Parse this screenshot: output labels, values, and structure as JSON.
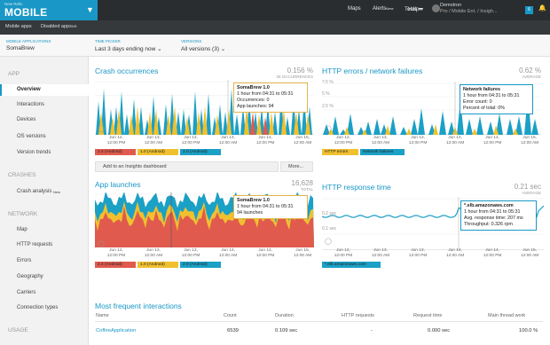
{
  "topbar": {
    "brand_small": "New Relic.",
    "brand_big": "MOBILE",
    "maps": "Maps",
    "alerts": "Alerts",
    "alerts_badge": "New",
    "tools": "Tools",
    "help": "Help",
    "user_name": "Demotron",
    "user_account": "Pro / Mobile Ent. / Insigh...",
    "notif_count": "6"
  },
  "subbar": {
    "mobile_apps": "Mobile apps",
    "disabled_apps": "Disabled apps",
    "disabled_badge": "NR"
  },
  "context": {
    "app_label": "MOBILE APPLICATIONS",
    "app_value": "SomaBrew",
    "time_label": "TIME PICKER",
    "time_value": "Last 3 days ending now",
    "versions_label": "VERSIONS",
    "versions_value": "All versions (3)"
  },
  "sidebar": {
    "sections": [
      {
        "title": "APP",
        "items": [
          {
            "label": "Overview",
            "active": true
          },
          {
            "label": "Interactions"
          },
          {
            "label": "Devices"
          },
          {
            "label": "OS versions"
          },
          {
            "label": "Version trends"
          }
        ]
      },
      {
        "title": "CRASHES",
        "items": [
          {
            "label": "Crash analysis",
            "badge": "New"
          }
        ]
      },
      {
        "title": "NETWORK",
        "items": [
          {
            "label": "Map"
          },
          {
            "label": "HTTP requests"
          },
          {
            "label": "Errors"
          },
          {
            "label": "Geography"
          },
          {
            "label": "Carriers"
          },
          {
            "label": "Connection types"
          }
        ]
      },
      {
        "title": "USAGE",
        "items": []
      }
    ]
  },
  "colors": {
    "accent": "#1997c6",
    "android24": "#e05a4e",
    "android10": "#f0c02f",
    "android20": "#1ba0c6",
    "http_err": "#f0c02f",
    "net_fail": "#1ba0c6",
    "tooltip_border": "#e3b44a"
  },
  "panels": {
    "crash": {
      "title": "Crash occurrences",
      "metric": "0.156",
      "metric_unit": "%",
      "metric_sub": "26 OCCURRENCES",
      "tooltip": {
        "title": "SomaBrew 1.0",
        "line1": "1 hour from 04:31 to 05:31",
        "line2": "Occurrences: 0",
        "line3": "App launches: 94"
      },
      "add_insights": "Add to an Insights dashboard",
      "more": "More..."
    },
    "http": {
      "title": "HTTP errors / network failures",
      "metric": "0.62",
      "metric_unit": "%",
      "metric_sub": "AVERAGE",
      "tooltip": {
        "title": "Network failures",
        "line1": "1 hour from 04:31 to 05:31",
        "line2": "Error count: 0",
        "line3": "Percent of total: 0%"
      }
    },
    "launches": {
      "title": "App launches",
      "metric": "16,628",
      "metric_sub": "TOTAL",
      "tooltip": {
        "title": "SomaBrew 1.0",
        "line1": "1 hour from 04:31 to 05:31",
        "line2": "94 launches"
      }
    },
    "response": {
      "title": "HTTP response time",
      "metric": "0.21",
      "metric_unit": "sec",
      "metric_sub": "AVERAGE",
      "tooltip": {
        "title": "*.elb.amazonaws.com",
        "line1": "1 hour from 04:31 to 05:31",
        "line2": "Avg. response time: 207 ms",
        "line3": "Throughput: 0.326 rpm"
      }
    }
  },
  "chart_data": [
    {
      "type": "area",
      "title": "Crash occurrences",
      "x": [
        "Jun 12, 12:00 PM",
        "Jun 13, 12:00 AM",
        "Jun 13, 12:00 PM",
        "Jun 14, 12:00 AM",
        "Jun 14, 12:00 PM",
        "Jun 15, 12:00 AM"
      ],
      "series": [
        {
          "name": "2.4 (Android)",
          "color": "#e05a4e",
          "values": [
            0,
            0,
            0,
            0,
            0,
            0,
            0,
            0,
            0,
            0,
            0,
            0,
            0,
            0,
            0,
            0,
            0,
            0,
            0,
            0,
            0,
            0,
            0,
            0,
            0,
            0,
            0,
            0,
            0,
            0,
            0,
            0,
            0,
            0,
            0,
            0,
            0,
            0,
            0,
            0,
            0,
            0,
            0,
            0,
            0,
            0,
            0,
            0,
            0,
            0,
            0,
            0,
            0,
            0,
            0,
            0,
            0,
            0,
            0,
            0,
            0,
            0,
            0,
            0,
            0,
            0,
            0,
            0,
            0,
            0,
            0,
            0,
            0,
            0,
            0,
            0,
            0,
            0,
            0,
            0,
            0,
            0,
            0,
            0,
            0,
            0,
            0,
            0,
            0,
            0,
            0,
            0,
            0,
            0,
            0,
            0,
            0,
            0,
            0,
            0,
            0,
            0,
            0,
            0,
            0,
            0,
            0,
            0,
            0,
            0,
            0,
            0,
            0,
            0,
            0,
            0,
            0,
            0,
            0,
            0
          ]
        },
        {
          "name": "1.0 (Android)",
          "color": "#f0c02f",
          "values": [
            0,
            0,
            3,
            0,
            0,
            5,
            0,
            2,
            0,
            0,
            0,
            6,
            1,
            0,
            0,
            0,
            4,
            0,
            0,
            0,
            0,
            0,
            0,
            0,
            5,
            0,
            0,
            0,
            0,
            0,
            0,
            0,
            0,
            0,
            0,
            0,
            0,
            0,
            0,
            0,
            0,
            0,
            0,
            0,
            0,
            0,
            0,
            0,
            0,
            0,
            0,
            0,
            0,
            0,
            0,
            0,
            0,
            0,
            0,
            0,
            0,
            0,
            0,
            0,
            0,
            0,
            0,
            0,
            0,
            0,
            0,
            0,
            0,
            0,
            0,
            0,
            0,
            0,
            0,
            0,
            0,
            0,
            0,
            0,
            0,
            0,
            0,
            0,
            0,
            0,
            0,
            0,
            0,
            0,
            0,
            0,
            0,
            0,
            0,
            0,
            0,
            0,
            0,
            0,
            0,
            0,
            0,
            0,
            0,
            0,
            0,
            0,
            0,
            0,
            0,
            0,
            0,
            0,
            0,
            0
          ]
        },
        {
          "name": "2.0 (Android)",
          "color": "#1ba0c6",
          "values": [
            0,
            0,
            0,
            0,
            0,
            0,
            0,
            0,
            0,
            0,
            0,
            0,
            0,
            0,
            0,
            0,
            0,
            0,
            0,
            0,
            0,
            0,
            0,
            0,
            0,
            0,
            0,
            0,
            0,
            0,
            0,
            0,
            0,
            0,
            0,
            0,
            0,
            0,
            0,
            0,
            0,
            0,
            0,
            0,
            0,
            0,
            0,
            0,
            0,
            0,
            0,
            0,
            0,
            0,
            0,
            0,
            0,
            0,
            0,
            0,
            0,
            0,
            0,
            0,
            0,
            0,
            0,
            0,
            0,
            0,
            0,
            0,
            0,
            0,
            0,
            0,
            0,
            0,
            0,
            0,
            0,
            0,
            0,
            0,
            0,
            0,
            0,
            0,
            0,
            0,
            0,
            0,
            0,
            0,
            0,
            0,
            0,
            0,
            0,
            0,
            0,
            0,
            0,
            0,
            0,
            0,
            0,
            0,
            0,
            0,
            0,
            0,
            0,
            0,
            0,
            0,
            0,
            0,
            0,
            0
          ]
        }
      ]
    }
  ],
  "chart_shapes": {
    "crash": [
      {
        "color": "#1ba0c6",
        "peaks": [
          [
            4,
            0.65
          ],
          [
            10,
            0.9
          ],
          [
            18,
            0.5
          ],
          [
            24,
            0.55
          ],
          [
            30,
            0.85
          ],
          [
            36,
            0.4
          ],
          [
            44,
            0.7
          ],
          [
            52,
            0.55
          ],
          [
            59,
            0.3
          ],
          [
            66,
            0.75
          ],
          [
            72,
            0.35
          ],
          [
            80,
            0.6
          ],
          [
            87,
            0.8
          ],
          [
            94,
            0.45
          ],
          [
            100,
            0.5
          ],
          [
            106,
            0.4
          ],
          [
            113,
            0.85
          ],
          [
            120,
            0.5
          ],
          [
            128,
            0.8
          ],
          [
            135,
            0.35
          ],
          [
            141,
            0.6
          ],
          [
            147,
            0.45
          ],
          [
            154,
            0.9
          ],
          [
            160,
            0.4
          ],
          [
            167,
            0.55
          ],
          [
            174,
            0.7
          ],
          [
            181,
            0.45
          ],
          [
            188,
            0.55
          ],
          [
            195,
            0.6
          ],
          [
            203,
            0.45
          ],
          [
            210,
            0.8
          ],
          [
            217,
            0.35
          ],
          [
            224,
            0.7
          ],
          [
            230,
            0.5
          ],
          [
            236,
            0.75
          ],
          [
            242,
            0.55
          ]
        ]
      },
      {
        "color": "#f0c02f",
        "peaks": [
          [
            7,
            0.45
          ],
          [
            20,
            0.35
          ],
          [
            27,
            0.5
          ],
          [
            41,
            0.4
          ],
          [
            48,
            0.55
          ],
          [
            62,
            0.45
          ],
          [
            69,
            0.5
          ],
          [
            83,
            0.4
          ],
          [
            90,
            0.55
          ],
          [
            104,
            0.35
          ],
          [
            117,
            0.45
          ],
          [
            124,
            0.55
          ],
          [
            138,
            0.4
          ],
          [
            151,
            0.5
          ],
          [
            171,
            0.55
          ],
          [
            185,
            0.4
          ],
          [
            199,
            0.45
          ],
          [
            213,
            0.5
          ],
          [
            227,
            0.45
          ],
          [
            240,
            0.4
          ]
        ]
      },
      {
        "color": "#e05a4e",
        "peaks": [
          [
            178,
            0.45
          ],
          [
            192,
            0.35
          ]
        ]
      }
    ]
  },
  "crash_legend": [
    "2.4 (Android)",
    "1.0 (Android)",
    "2.0 (Android)"
  ],
  "crash_x": [
    [
      "Jun 12,",
      "12:00 PM"
    ],
    [
      "Jun 13,",
      "12:00 AM"
    ],
    [
      "Jun 13,",
      "12:00 PM"
    ],
    [
      "Jun 14,",
      "12:00 AM"
    ],
    [
      "Jun 14,",
      "12:00 PM"
    ],
    [
      "Jun 15,",
      "12:00 AM"
    ]
  ],
  "http_y": [
    "7.5 %",
    "5 %",
    "2.5 %"
  ],
  "http_x": [
    [
      "Jun 12,",
      "12:00 PM"
    ],
    [
      "Jun 13,",
      "12:00 AM"
    ],
    [
      "Jun 13,",
      "12:00 PM"
    ],
    [
      "Jun 14,",
      "12:00 AM"
    ],
    [
      "Jun 14,",
      "12:00 PM"
    ],
    [
      "Jun 15,",
      "12:00 AM"
    ]
  ],
  "http_legend": [
    "HTTP errors",
    "Network failures"
  ],
  "launch_x": [
    [
      "Jun 12,",
      "12:00 PM"
    ],
    [
      "Jun 13,",
      "12:00 AM"
    ],
    [
      "Jun 13,",
      "12:00 PM"
    ],
    [
      "Jun 14,",
      "12:00 AM"
    ],
    [
      "Jun 14,",
      "12:00 PM"
    ],
    [
      "Jun 15,",
      "12:00 AM"
    ]
  ],
  "launch_legend": [
    "2.4 (Android)",
    "1.0 (Android)",
    "2.0 (Android)"
  ],
  "resp_y": [
    "0.2 sec",
    "0.1 sec"
  ],
  "resp_x": [
    [
      "Jun 12,",
      "12:00 PM"
    ],
    [
      "Jun 13,",
      "12:00 AM"
    ],
    [
      "Jun 13,",
      "12:00 PM"
    ],
    [
      "Jun 14,",
      "12:00 AM"
    ],
    [
      "Jun 14,",
      "12:00 PM"
    ],
    [
      "Jun 15,",
      "12:00 AM"
    ]
  ],
  "resp_legend": [
    "*.elb.amazonaws.com"
  ],
  "table": {
    "title": "Most frequent interactions",
    "headers": [
      "Name",
      "Count",
      "Duration",
      "HTTP requests",
      "Request time",
      "Main thread work"
    ],
    "rows": [
      [
        "CoffeeApplication",
        "6539",
        "0.109 sec",
        "-",
        "0.000 sec",
        "100.0 %"
      ]
    ]
  }
}
